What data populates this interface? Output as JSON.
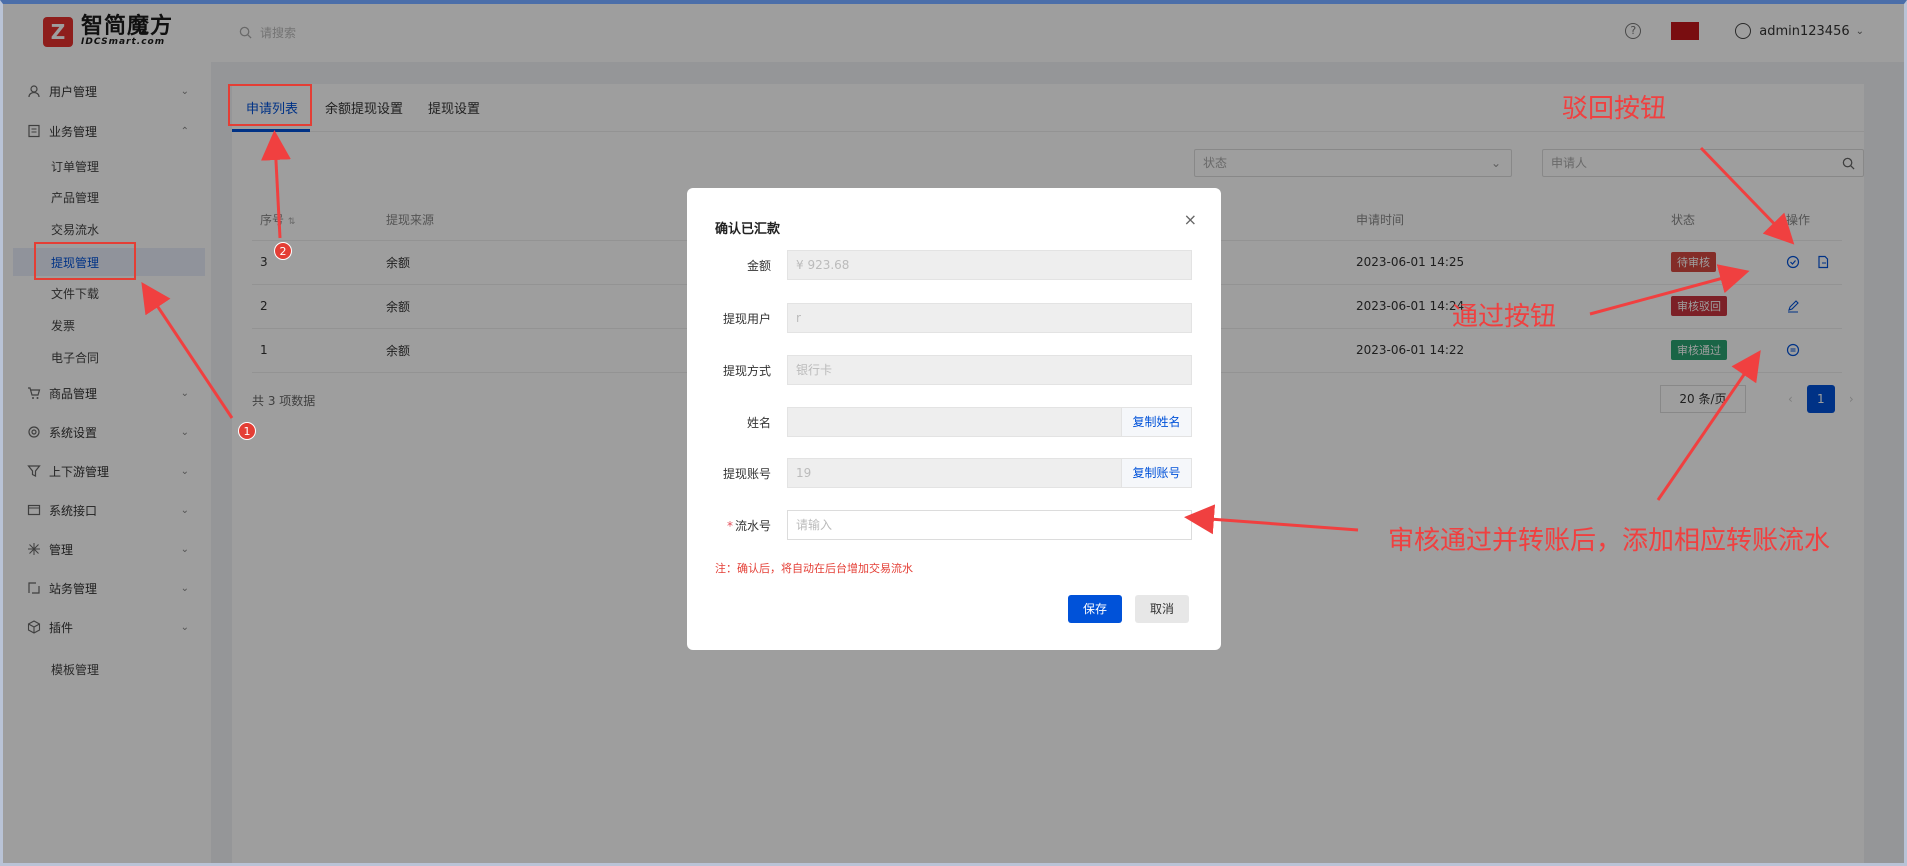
{
  "brand": {
    "name_cn": "智简魔方",
    "name_en": "IDCSmart.com",
    "mark": "Z"
  },
  "header": {
    "search_placeholder": "请搜索",
    "user": "admin123456"
  },
  "sidebar": {
    "groups": [
      {
        "label": "用户管理",
        "icon": "user-icon"
      },
      {
        "label": "业务管理",
        "icon": "document-icon",
        "expanded": true
      },
      {
        "label": "商品管理",
        "icon": "cart-icon"
      },
      {
        "label": "系统设置",
        "icon": "gear-icon"
      },
      {
        "label": "上下游管理",
        "icon": "funnel-icon"
      },
      {
        "label": "系统接口",
        "icon": "window-icon"
      },
      {
        "label": "管理",
        "icon": "spark-icon"
      },
      {
        "label": "站务管理",
        "icon": "site-icon"
      },
      {
        "label": "插件",
        "icon": "cube-icon"
      }
    ],
    "sub_items": [
      "订单管理",
      "产品管理",
      "交易流水",
      "提现管理",
      "文件下载",
      "发票",
      "电子合同"
    ],
    "tail_item": "模板管理",
    "active_sub": "提现管理"
  },
  "tabs": [
    "申请列表",
    "余额提现设置",
    "提现设置"
  ],
  "filters": {
    "status_placeholder": "状态",
    "applicant_placeholder": "申请人"
  },
  "table": {
    "columns": [
      "序号",
      "提现来源",
      "申请时间",
      "状态",
      "操作"
    ],
    "rows": [
      {
        "id": "3",
        "source": "余额",
        "time": "2023-06-01 14:25",
        "status": "待审核",
        "status_color": "#d54941"
      },
      {
        "id": "2",
        "source": "余额",
        "time": "2023-06-01 14:24",
        "status": "审核驳回",
        "status_color": "#c9353f"
      },
      {
        "id": "1",
        "source": "余额",
        "time": "2023-06-01 14:22",
        "status": "审核通过",
        "status_color": "#2ba471"
      }
    ]
  },
  "footer": {
    "total": "共 3 项数据",
    "page_size": "20 条/页",
    "current_page": "1"
  },
  "modal": {
    "title": "确认已汇款",
    "close": "×",
    "fields": [
      {
        "label": "金额",
        "value": "¥ 923.68"
      },
      {
        "label": "提现用户",
        "value": "r"
      },
      {
        "label": "提现方式",
        "value": "银行卡"
      },
      {
        "label": "姓名",
        "value": "",
        "copy": "复制姓名"
      },
      {
        "label": "提现账号",
        "value": "19",
        "copy": "复制账号"
      },
      {
        "label": "流水号",
        "placeholder": "请输入",
        "required": true
      }
    ],
    "note": "注：确认后，将自动在后台增加交易流水",
    "save": "保存",
    "cancel": "取消"
  },
  "annotations": {
    "reject": "驳回按钮",
    "approve": "通过按钮",
    "flow": "审核通过并转账后，添加相应转账流水",
    "badge1": "1",
    "badge2": "2"
  },
  "colors": {
    "primary": "#0052d9",
    "annotation": "#f04040"
  }
}
